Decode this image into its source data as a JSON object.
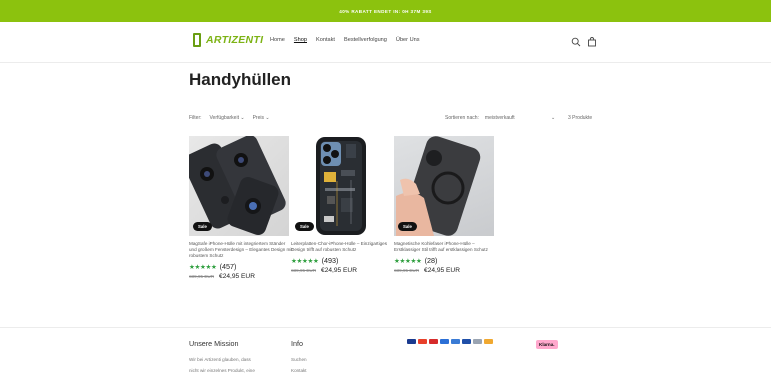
{
  "announcement": "40% RABATT ENDET IN: 0H 37M 39S",
  "brand": {
    "name": "ARTIZENTI",
    "color": "#7db315"
  },
  "nav": [
    "Home",
    "Shop",
    "Kontakt",
    "Bestellverfolgung",
    "Über Uns"
  ],
  "nav_active": "Shop",
  "header_icons": [
    "search-icon",
    "bag-icon"
  ],
  "page_title": "Handyhüllen",
  "filters": {
    "label": "Filter:",
    "availability": "Verfügbarkeit",
    "price": "Preis"
  },
  "sort": {
    "label": "Sortieren nach:",
    "value": "meistverkauft"
  },
  "product_count": "3 Produkte",
  "products": [
    {
      "badge": "Sale",
      "title": "MagSafe iPhone-Hülle mit integriertem Ständer und großem Fensterdesign – Elegantes Design mit robustem Schutz",
      "stars": "★★★★★",
      "rating_count": "(457)",
      "rating": 5,
      "old_price": "€39,95 EUR",
      "price": "€24,95 EUR"
    },
    {
      "badge": "Sale",
      "title": "Leiterplatten-Chor-iPhone-Hülle – Einzigartiges Design trifft auf robusten Schutz",
      "stars": "★★★★★",
      "rating_count": "(493)",
      "rating": 5,
      "old_price": "€39,95 EUR",
      "price": "€24,95 EUR"
    },
    {
      "badge": "Sale",
      "title": "Magnetische Kohlefaser iPhone-Hülle – Erstklassiger Stil trifft auf erstklassigen Schutz",
      "stars": "★★★★★",
      "rating_count": "(28)",
      "rating": 5,
      "old_price": "€39,95 EUR",
      "price": "€24,95 EUR"
    }
  ],
  "footer": {
    "mission_title": "Unsere Mission",
    "mission_text_1": "Wir bei Artizenti glauben, dass",
    "mission_text_2": "nicht wir einzelnes Produkt, eine",
    "info_title": "Info",
    "info_links": [
      "Suchen",
      "Kontakt"
    ],
    "payment_icons": [
      "visa-icon",
      "mastercard-icon",
      "maestro-icon",
      "amex-icon",
      "bank-icon",
      "card-icon",
      "applepay-icon",
      "paypal-icon"
    ],
    "klarna": "Klarna."
  }
}
